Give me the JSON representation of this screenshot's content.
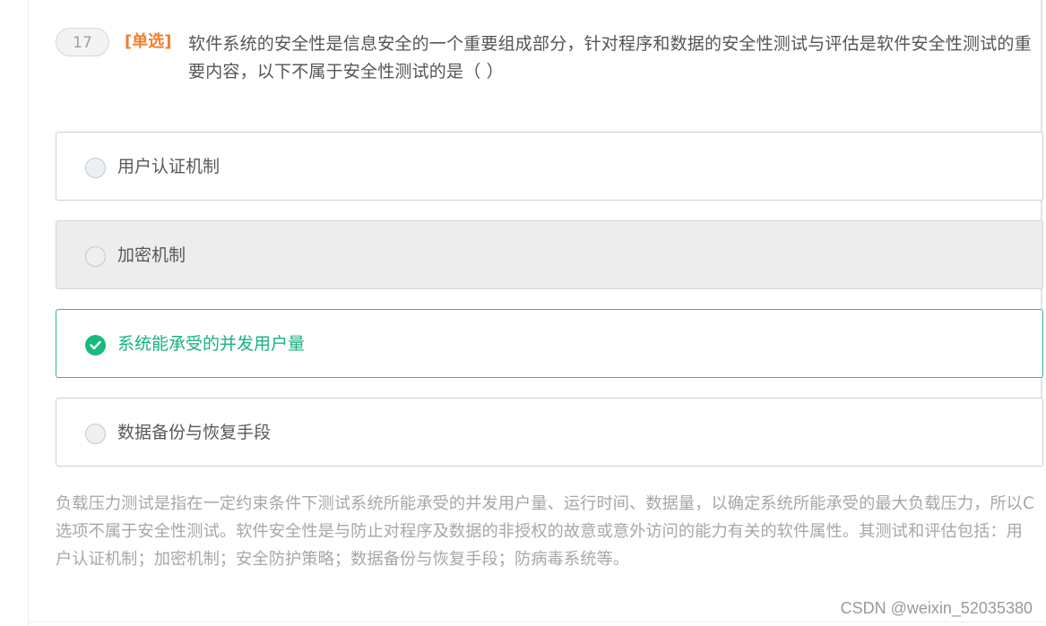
{
  "question": {
    "number": "17",
    "type_label": "[单选]",
    "text": "软件系统的安全性是信息安全的一个重要组成部分，针对程序和数据的安全性测试与评估是软件安全性测试的重要内容，以下不属于安全性测试的是（ ）"
  },
  "options": [
    {
      "label": "用户认证机制",
      "state": "unselected"
    },
    {
      "label": "加密机制",
      "state": "hover"
    },
    {
      "label": "系统能承受的并发用户量",
      "state": "correct"
    },
    {
      "label": "数据备份与恢复手段",
      "state": "unselected"
    }
  ],
  "explanation": "负载压力测试是指在一定约束条件下测试系统所能承受的并发用户量、运行时间、数据量，以确定系统所能承受的最大负载压力，所以C选项不属于安全性测试。软件安全性是与防止对程序及数据的非授权的故意或意外访问的能力有关的软件属性。其测试和评估包括：用户认证机制；加密机制；安全防护策略；数据备份与恢复手段；防病毒系统等。",
  "watermark": "CSDN @weixin_52035380",
  "colors": {
    "accent_orange": "#f07f2d",
    "correct_green": "#17b97e",
    "hover_bg": "#ededed",
    "text_gray": "#595959",
    "explain_gray": "#a7a7a7"
  },
  "icons": {
    "radio": "radio-circle-icon",
    "correct": "check-circle-icon"
  }
}
